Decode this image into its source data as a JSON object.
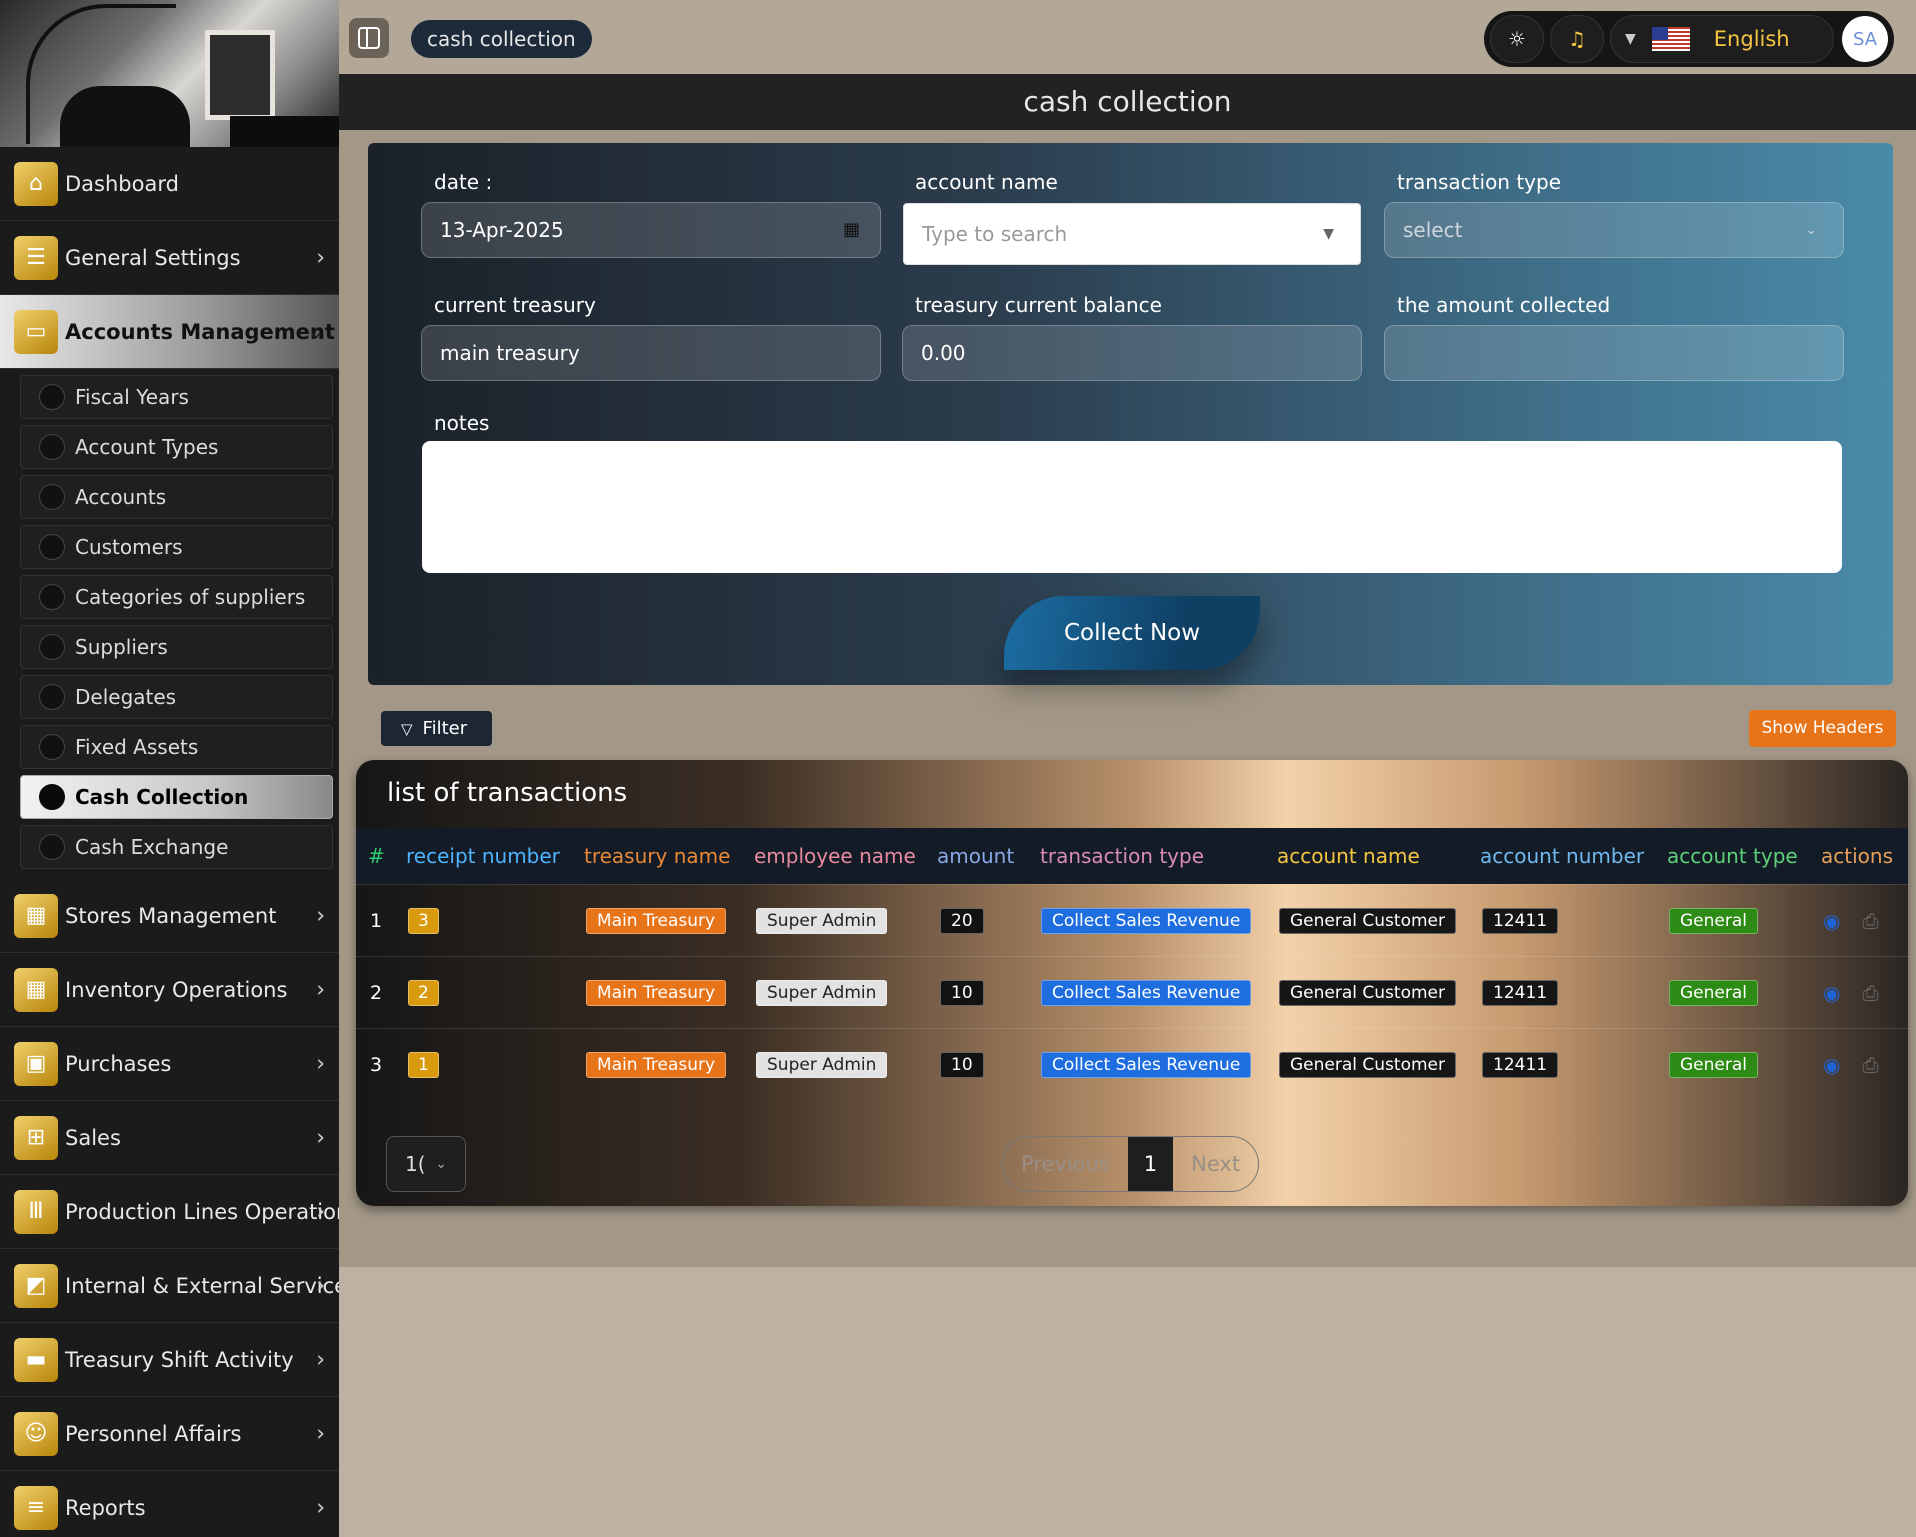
{
  "sidebar": {
    "items": [
      {
        "label": "Dashboard",
        "icon": "home-icon",
        "has_children": false
      },
      {
        "label": "General Settings",
        "icon": "sliders-icon",
        "has_children": true
      },
      {
        "label": "Accounts Management",
        "icon": "wallet-icon",
        "has_children": true,
        "expanded": true
      }
    ],
    "sub_items": [
      {
        "label": "Fiscal Years"
      },
      {
        "label": "Account Types"
      },
      {
        "label": "Accounts"
      },
      {
        "label": "Customers"
      },
      {
        "label": "Categories of suppliers"
      },
      {
        "label": "Suppliers"
      },
      {
        "label": "Delegates"
      },
      {
        "label": "Fixed Assets"
      },
      {
        "label": "Cash Collection",
        "active": true
      },
      {
        "label": "Cash Exchange"
      }
    ],
    "items_after": [
      {
        "label": "Stores Management",
        "icon": "building-icon"
      },
      {
        "label": "Inventory Operations",
        "icon": "building-icon"
      },
      {
        "label": "Purchases",
        "icon": "bag-icon"
      },
      {
        "label": "Sales",
        "icon": "cart-icon"
      },
      {
        "label": "Production Lines Operations",
        "icon": "bars-icon"
      },
      {
        "label": "Internal & External Services",
        "icon": "service-icon"
      },
      {
        "label": "Treasury Shift Activity",
        "icon": "card-icon"
      },
      {
        "label": "Personnel Affairs",
        "icon": "people-icon"
      },
      {
        "label": "Reports",
        "icon": "list-icon"
      }
    ]
  },
  "topbar": {
    "breadcrumb": "cash collection",
    "language": "English",
    "avatar_initials": "SA"
  },
  "page": {
    "title": "cash collection"
  },
  "form": {
    "date_label": "date :",
    "date_value": "13-Apr-2025",
    "account_name_label": "account name",
    "account_name_placeholder": "Type to search",
    "transaction_type_label": "transaction type",
    "transaction_type_value": "select",
    "current_treasury_label": "current treasury",
    "current_treasury_value": "main treasury",
    "treasury_balance_label": "treasury current balance",
    "treasury_balance_value": "0.00",
    "amount_collected_label": "the amount collected",
    "amount_collected_value": "",
    "notes_label": "notes",
    "submit_label": "Collect Now"
  },
  "toolbar": {
    "filter_label": "Filter",
    "show_headers_label": "Show Headers"
  },
  "table": {
    "title": "list of transactions",
    "columns": [
      {
        "label": "#",
        "color": "#2ecc71"
      },
      {
        "label": "receipt number",
        "color": "#4fb3ff"
      },
      {
        "label": "treasury name",
        "color": "#e8893a"
      },
      {
        "label": "employee name",
        "color": "#e98aa0"
      },
      {
        "label": "amount",
        "color": "#8aa8e8"
      },
      {
        "label": "transaction type",
        "color": "#d98ab8"
      },
      {
        "label": "account name",
        "color": "#f5c542"
      },
      {
        "label": "account number",
        "color": "#6fb8f0"
      },
      {
        "label": "account type",
        "color": "#5fd07a"
      },
      {
        "label": "actions",
        "color": "#e8a05a"
      }
    ],
    "rows": [
      {
        "idx": "1",
        "receipt": "3",
        "treasury": "Main Treasury",
        "employee": "Super Admin",
        "amount": "20",
        "type": "Collect Sales Revenue",
        "account": "General Customer",
        "number": "12411",
        "acc_type": "General"
      },
      {
        "idx": "2",
        "receipt": "2",
        "treasury": "Main Treasury",
        "employee": "Super Admin",
        "amount": "10",
        "type": "Collect Sales Revenue",
        "account": "General Customer",
        "number": "12411",
        "acc_type": "General"
      },
      {
        "idx": "3",
        "receipt": "1",
        "treasury": "Main Treasury",
        "employee": "Super Admin",
        "amount": "10",
        "type": "Collect Sales Revenue",
        "account": "General Customer",
        "number": "12411",
        "acc_type": "General"
      }
    ],
    "per_page": "1(",
    "pagination": {
      "previous": "Previous",
      "current": "1",
      "next": "Next"
    }
  }
}
